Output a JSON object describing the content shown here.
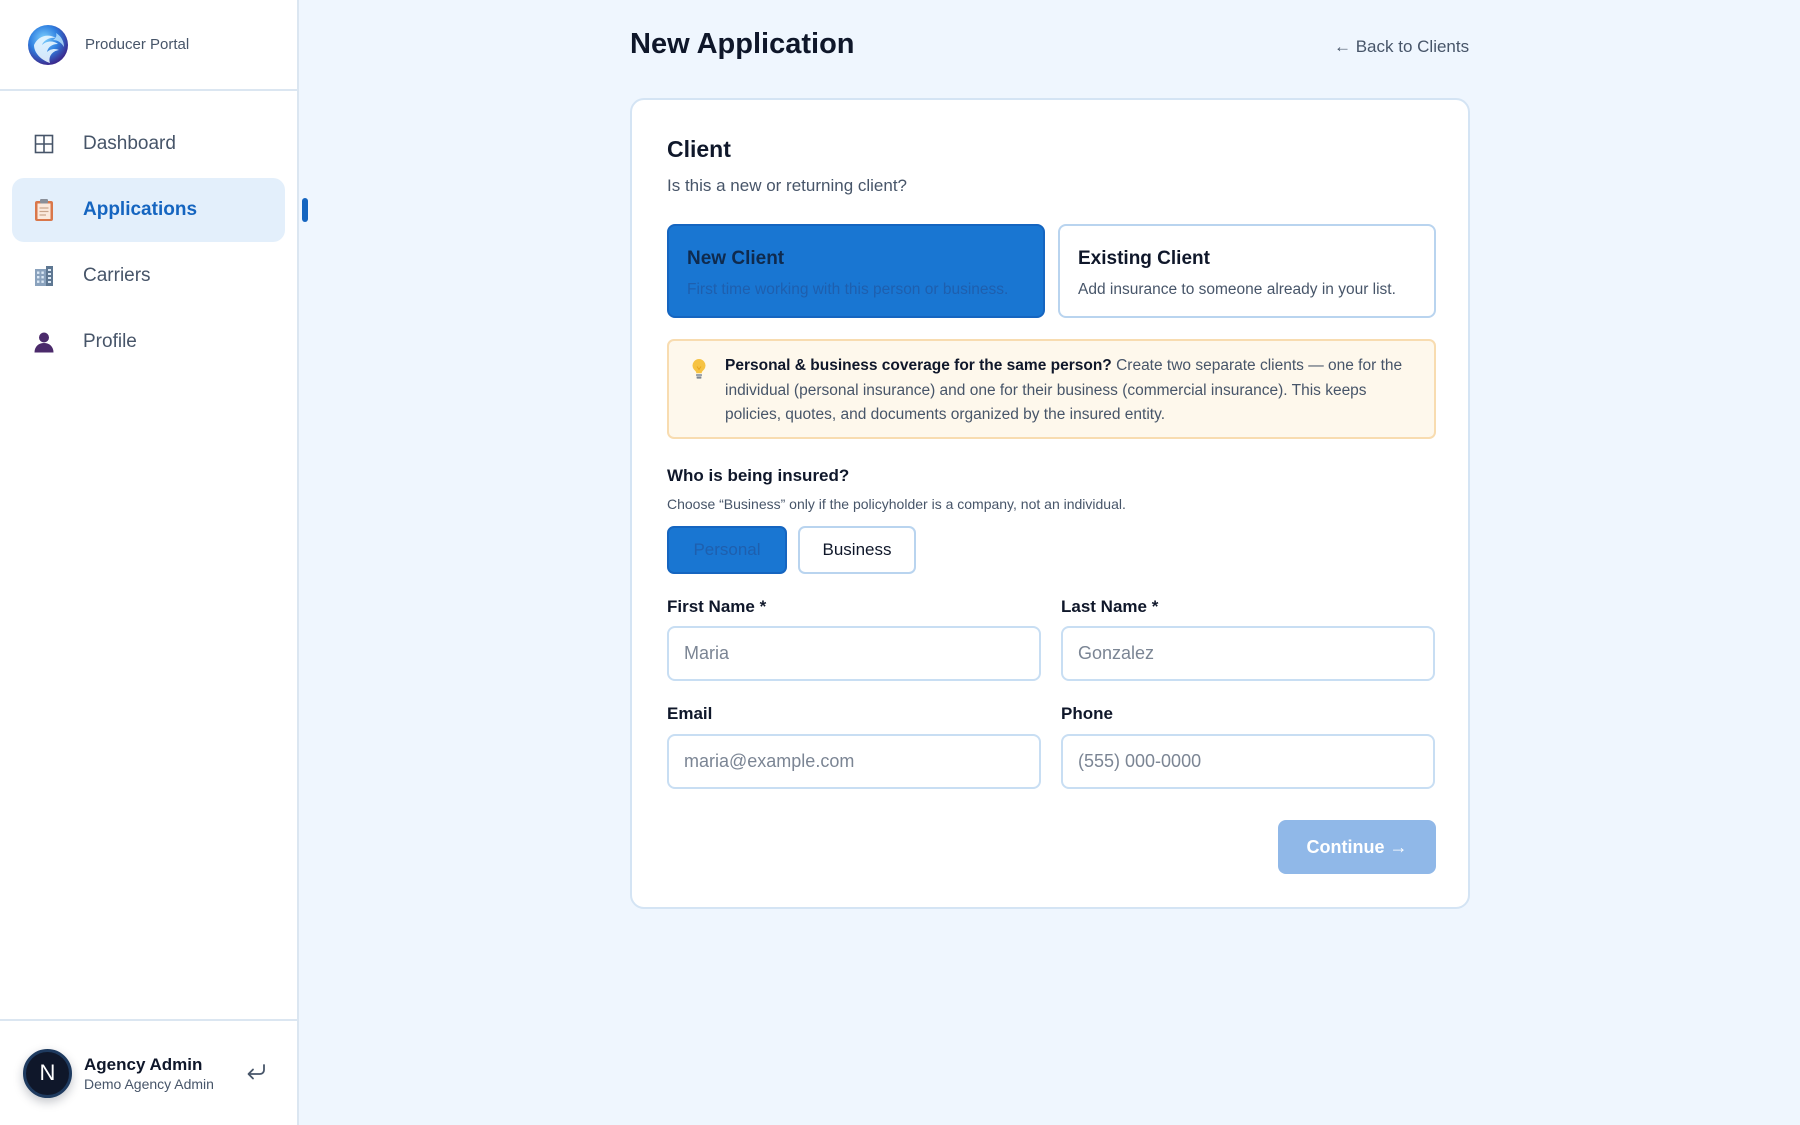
{
  "app": {
    "brand_name": "Producer Portal"
  },
  "sidebar": {
    "items": [
      {
        "label": "Dashboard",
        "icon": "grid-icon"
      },
      {
        "label": "Applications",
        "icon": "clipboard-icon",
        "active": true
      },
      {
        "label": "Carriers",
        "icon": "office-building-icon"
      },
      {
        "label": "Profile",
        "icon": "person-icon"
      }
    ],
    "user": {
      "initial": "N",
      "name": "Agency Admin",
      "org": "Demo Agency Admin"
    }
  },
  "header": {
    "title": "New Application",
    "back_link": "← Back to Clients"
  },
  "form": {
    "section_title": "Client",
    "section_subtitle": "Is this a new or returning client?",
    "client_types": [
      {
        "title": "New Client",
        "description": "First time working with this person or business.",
        "selected": true
      },
      {
        "title": "Existing Client",
        "description": "Add insurance to someone already in your list.",
        "selected": false
      }
    ],
    "tip": {
      "bold": "Personal & business coverage for the same person?",
      "text": " Create two separate clients — one for the individual (personal insurance) and one for their business (commercial insurance). This keeps policies, quotes, and documents organized by the insured entity."
    },
    "insured": {
      "label": "Who is being insured?",
      "hint": "Choose “Business” only if the policyholder is a company, not an individual.",
      "options": [
        "Personal",
        "Business"
      ],
      "selected": "Personal"
    },
    "fields": {
      "first_name": {
        "label": "First Name *",
        "placeholder": "Maria",
        "value": ""
      },
      "last_name": {
        "label": "Last Name *",
        "placeholder": "Gonzalez",
        "value": ""
      },
      "email": {
        "label": "Email",
        "placeholder": "maria@example.com",
        "value": ""
      },
      "phone": {
        "label": "Phone",
        "placeholder": "(555) 000-0000",
        "value": ""
      }
    },
    "continue_label": "Continue →"
  },
  "colors": {
    "accent": "#1976d2",
    "accent_dark": "#1565c0",
    "page_bg": "#eff6fe",
    "tip_bg": "#fef8ec",
    "button_disabled": "#90b8e8"
  }
}
